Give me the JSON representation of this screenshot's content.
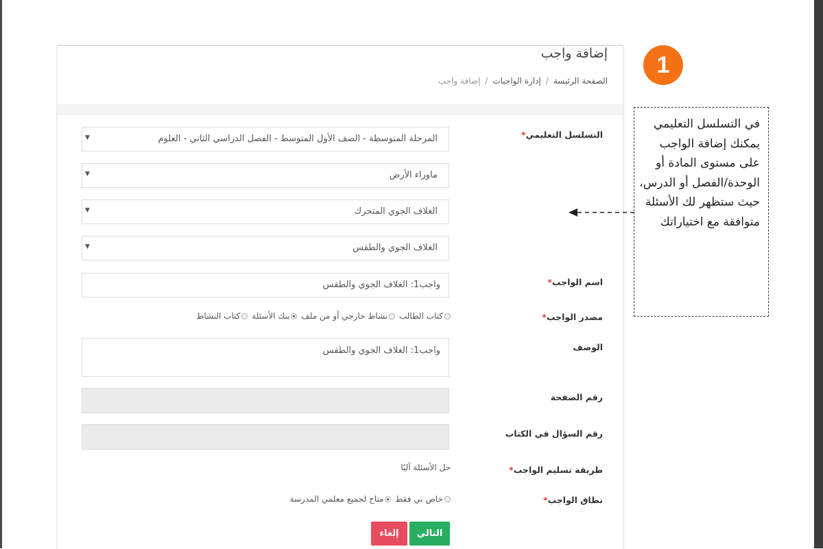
{
  "header": {
    "title": "إضافة واجب",
    "breadcrumb": [
      "الصفحة الرئيسة",
      "إدارة الواجبات",
      "إضافة واجب"
    ]
  },
  "form": {
    "hierarchy_label": "التسلسل التعليمي",
    "hierarchy_select": "المرحلة المتوسطة - الصف الأول المتوسط - الفصل الدراسي الثاني - العلوم",
    "unit_select": "ماوراء الأرض",
    "chapter_select": "الغلاف الجوي المتحرك",
    "lesson_select": "الغلاف الجوي والطقس",
    "homework_name_label": "اسم الواجب",
    "homework_name_value": "واجب1: الغلاف الجوي والطقس",
    "source_label": "مصدر الواجب",
    "source_options": [
      "كتاب الطالب",
      "نشاط خارجي أو من ملف",
      "بنك الأسئلة",
      "كتاب النشاط"
    ],
    "source_selected": 2,
    "description_label": "الوصف",
    "description_value": "واجب1: الغلاف الجوي والطقس",
    "page_number_label": "رقم الصفحة",
    "question_number_label": "رقم السؤال في الكتاب",
    "delivery_label": "طريقة تسليم الواجب",
    "delivery_value": "حل الأسئلة آليًا",
    "scope_label": "نطاق الواجب",
    "scope_options": [
      "خاص بي فقط",
      "متاح لجميع معلمي المدرسة"
    ],
    "scope_selected": 1,
    "required_mark": "*"
  },
  "buttons": {
    "next": "التالي",
    "cancel": "إلغاء"
  },
  "annotation": {
    "step_number": "1",
    "callout_text": "في التسلسل التعليمي يمكنك إضافة الواجب على مستوى المادة أو الوحدة/الفصل أو الدرس، حيث ستظهر لك الأسئلة متوافقة مع اختياراتك",
    "badge_color": "#f47216"
  },
  "colors": {
    "next_button": "#27ae60",
    "cancel_button": "#e84c5f",
    "required": "#e53935"
  }
}
